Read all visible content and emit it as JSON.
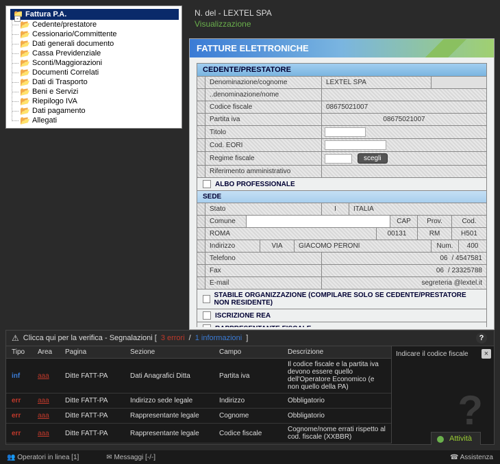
{
  "tree": {
    "root": "Fattura P.A.",
    "toggle": "-",
    "items": [
      "Cedente/prestatore",
      "Cessionario/Committente",
      "Dati generali documento",
      "Cassa Previdenziale",
      "Sconti/Maggiorazioni",
      "Documenti Correlati",
      "Dati di Trasporto",
      "Beni e Servizi",
      "Riepilogo IVA",
      "Dati pagamento",
      "Allegati"
    ]
  },
  "header": {
    "title": "N. del - LEXTEL SPA",
    "sub": "Visualizzazione"
  },
  "main": {
    "title": "FATTURE ELETTRONICHE",
    "section1": "CEDENTE/PRESTATORE",
    "rows": {
      "denominazione": {
        "l": "Denominazione/cognome",
        "v": "LEXTEL SPA"
      },
      "nome": {
        "l": "..denominazione/nome",
        "v": ""
      },
      "cf": {
        "l": "Codice fiscale",
        "v": "08675021007"
      },
      "piva": {
        "l": "Partita iva",
        "v": "08675021007"
      },
      "titolo": {
        "l": "Titolo",
        "v": ""
      },
      "eori": {
        "l": "Cod. EORI",
        "v": ""
      },
      "regime": {
        "l": "Regime fiscale",
        "btn": "scegli"
      },
      "rifamm": {
        "l": "Riferimento amministrativo",
        "v": ""
      }
    },
    "chk1": "ALBO PROFESSIONALE",
    "sede": "SEDE",
    "stato": {
      "l": "Stato",
      "code": "I",
      "v": "ITALIA"
    },
    "comune": {
      "l": "Comune",
      "city": "ROMA",
      "cap_l": "CAP",
      "cap": "00131",
      "prov_l": "Prov.",
      "prov": "RM",
      "cod_l": "Cod.",
      "cod": "H501"
    },
    "indirizzo": {
      "l": "Indirizzo",
      "via_l": "VIA",
      "via": "GIACOMO PERONI",
      "num_l": "Num.",
      "num": "400"
    },
    "tel": {
      "l": "Telefono",
      "pre": "06",
      "v": "/ 4547581"
    },
    "fax": {
      "l": "Fax",
      "pre": "06",
      "v": "/ 23325788"
    },
    "email": {
      "l": "E-mail",
      "v": "segreteria @lextel.it"
    },
    "chk2": "STABILE ORGANIZZAZIONE (COMPILARE SOLO SE CEDENTE/PRESTATORE NON RESIDENTE)",
    "chk3": "ISCRIZIONE REA",
    "chk4": "RAPPRESENTANTE FISCALE"
  },
  "report": {
    "head_pre": "Clicca qui per la verifica - Segnalazioni [ ",
    "errori": "3 errori",
    "sep": " / ",
    "info": "1 informazioni",
    "head_post": "]",
    "cols": [
      "Tipo",
      "Area",
      "Pagina",
      "Sezione",
      "Campo",
      "Descrizione"
    ],
    "rows": [
      {
        "tipo": "inf",
        "area": "aaa",
        "pag": "Ditte FATT-PA",
        "sez": "Dati Anagrafici Ditta",
        "campo": "Partita iva",
        "desc": "Il codice fiscale e la partita iva devono essere quello dell'Operatore Economico (e non quello della PA)"
      },
      {
        "tipo": "err",
        "area": "aaa",
        "pag": "Ditte FATT-PA",
        "sez": "Indirizzo sede legale",
        "campo": "Indirizzo",
        "desc": "Obbligatorio"
      },
      {
        "tipo": "err",
        "area": "aaa",
        "pag": "Ditte FATT-PA",
        "sez": "Rappresentante legale",
        "campo": "Cognome",
        "desc": "Obbligatorio"
      },
      {
        "tipo": "err",
        "area": "aaa",
        "pag": "Ditte FATT-PA",
        "sez": "Rappresentante legale",
        "campo": "Codice fiscale",
        "desc": "Cognome/nome errati rispetto al cod. fiscale (XXBBR)"
      }
    ],
    "help": "Indicare il codice fiscale"
  },
  "activity": "Attività",
  "status": {
    "ops": "Operatori in linea [1]",
    "msg": "Messaggi [-/-]",
    "assist": "Assistenza"
  }
}
